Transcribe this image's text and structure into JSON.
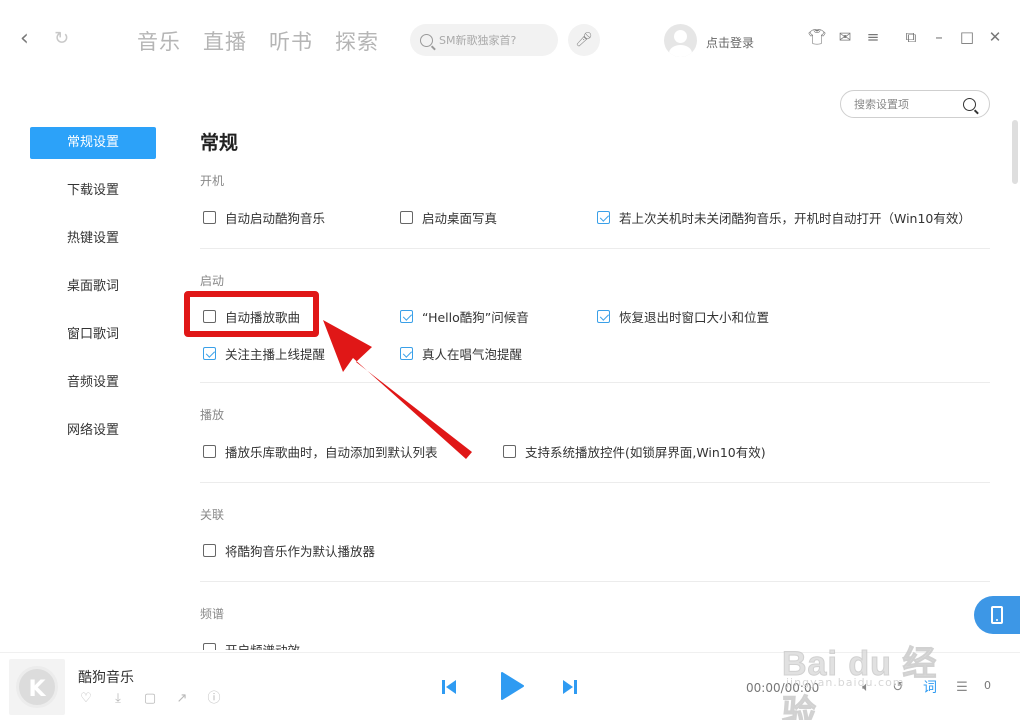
{
  "header": {
    "tabs": [
      "音乐",
      "直播",
      "听书",
      "探索"
    ],
    "search_placeholder": "SM新歌独家首?",
    "login_text": "点击登录"
  },
  "sidebar": {
    "items": [
      {
        "label": "常规设置",
        "active": true
      },
      {
        "label": "下载设置",
        "active": false
      },
      {
        "label": "热键设置",
        "active": false
      },
      {
        "label": "桌面歌词",
        "active": false
      },
      {
        "label": "窗口歌词",
        "active": false
      },
      {
        "label": "音频设置",
        "active": false
      },
      {
        "label": "网络设置",
        "active": false
      }
    ]
  },
  "settings_search": {
    "placeholder": "搜索设置项"
  },
  "page": {
    "title": "常规",
    "sections": {
      "boot": {
        "title": "开机",
        "options": [
          {
            "label": "自动启动酷狗音乐",
            "checked": false
          },
          {
            "label": "启动桌面写真",
            "checked": false
          },
          {
            "label": "若上次关机时未关闭酷狗音乐，开机时自动打开（Win10有效）",
            "checked": true
          }
        ]
      },
      "startup": {
        "title": "启动",
        "options": [
          {
            "label": "自动播放歌曲",
            "checked": false
          },
          {
            "label": "“Hello酷狗”问候音",
            "checked": true
          },
          {
            "label": "恢复退出时窗口大小和位置",
            "checked": true
          },
          {
            "label": "关注主播上线提醒",
            "checked": true
          },
          {
            "label": "真人在唱气泡提醒",
            "checked": true
          }
        ]
      },
      "playback": {
        "title": "播放",
        "options": [
          {
            "label": "播放乐库歌曲时，自动添加到默认列表",
            "checked": false
          },
          {
            "label": "支持系统播放控件(如锁屏界面,Win10有效)",
            "checked": false
          }
        ]
      },
      "association": {
        "title": "关联",
        "options": [
          {
            "label": "将酷狗音乐作为默认播放器",
            "checked": false
          }
        ]
      },
      "spectrum": {
        "title": "频谱",
        "options": [
          {
            "label": "开启频谱动效",
            "checked": false
          }
        ]
      }
    }
  },
  "player": {
    "song_name": "酷狗音乐",
    "cover_letter": "K",
    "time": "00:00/00:00",
    "lyric_label": "词",
    "queue_count": "0"
  },
  "watermark": {
    "text": "Bai du 经验",
    "sub": "jingyan.baidu.com"
  },
  "colors": {
    "accent": "#2ca2f9",
    "highlight": "#e01717"
  }
}
